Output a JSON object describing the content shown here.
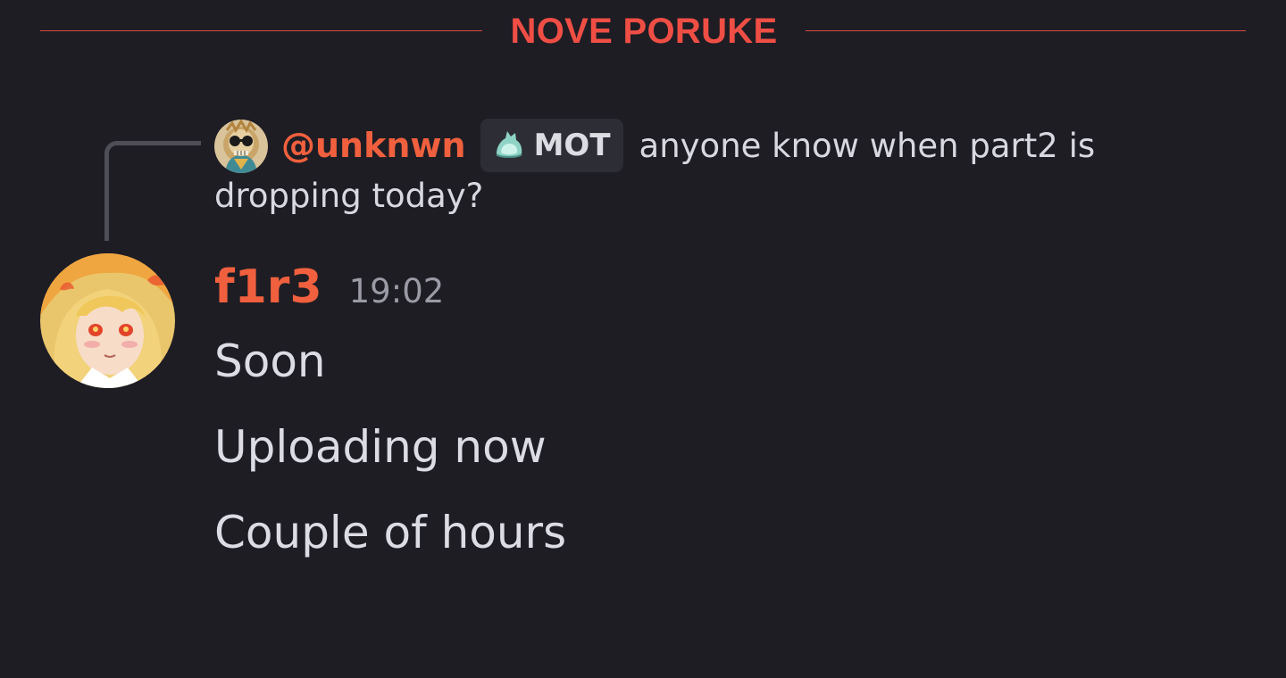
{
  "divider": {
    "label": "NOVE PORUKE",
    "color": "#ef4e45"
  },
  "reply": {
    "avatar_icon": "user-avatar-skull-sunglasses",
    "username": "@unknwn",
    "role": {
      "icon": "crystal-slime-icon",
      "name": "MOT"
    },
    "text_line1": "anyone know when part2 is",
    "text_line2": "dropping today?"
  },
  "message": {
    "avatar_icon": "user-avatar-anime-girl",
    "author": "f1r3",
    "author_color": "#f0603e",
    "timestamp": "19:02",
    "lines": [
      "Soon",
      "Uploading now",
      "Couple of hours"
    ]
  }
}
